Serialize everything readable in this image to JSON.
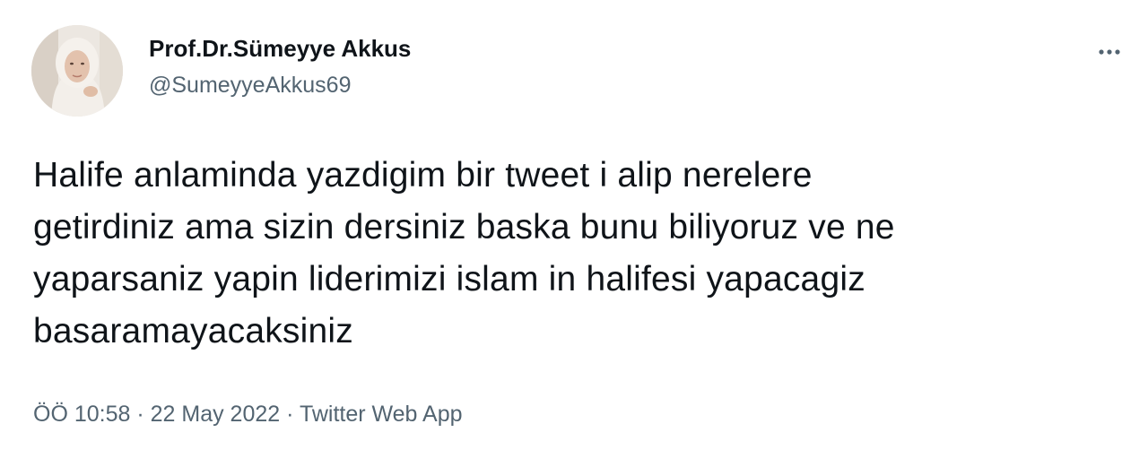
{
  "author": {
    "display_name": "Prof.Dr.Sümeyye Akkus",
    "handle": "@SumeyyeAkkus69"
  },
  "tweet": {
    "text": "Halife anlaminda yazdigim bir tweet i alip nerelere\ngetirdiniz ama sizin dersiniz baska bunu biliyoruz ve ne\nyaparsaniz yapin liderimizi islam in halifesi yapacagiz\nbasaramayacaksiniz"
  },
  "meta": {
    "time": "ÖÖ 10:58",
    "separator": " · ",
    "date": "22 May 2022",
    "source": "Twitter Web App"
  },
  "icons": {
    "more": "more-horizontal-icon",
    "avatar": "profile-photo"
  },
  "colors": {
    "text_primary": "#0f1419",
    "text_secondary": "#536471"
  }
}
